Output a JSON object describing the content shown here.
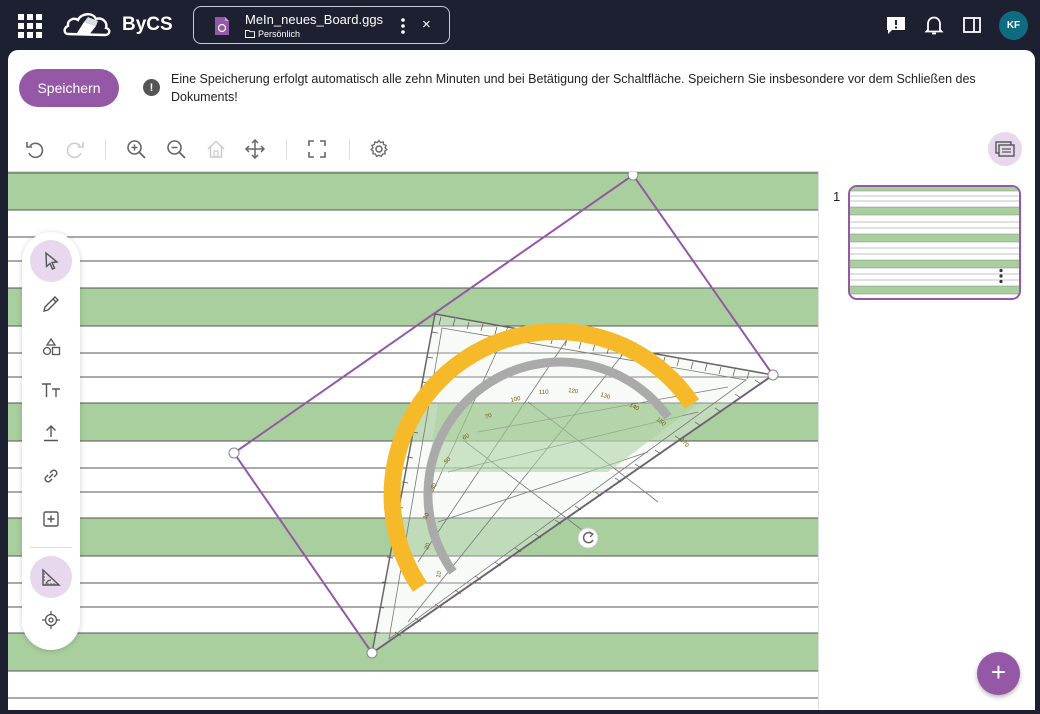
{
  "header": {
    "brand": "ByCS",
    "file_name": "MeIn_neues_Board.ggs",
    "file_location": "Persönlich",
    "close_glyph": "×",
    "avatar_initials": "KF",
    "icons": [
      "apps-grid-icon",
      "feedback-icon",
      "notifications-bell-icon",
      "side-panel-icon"
    ]
  },
  "save_bar": {
    "save_label": "Speichern",
    "info_glyph": "!",
    "info_text": "Eine Speicherung erfolgt automatisch alle zehn Minuten und bei Betätigung der Schaltfläche. Speichern Sie insbesondere vor dem Schließen des Dokuments!"
  },
  "toolbar": {
    "icons": [
      "undo-icon",
      "redo-icon",
      "zoom-in-icon",
      "zoom-out-icon",
      "home-view-icon",
      "pan-icon",
      "fullscreen-icon",
      "settings-icon",
      "pages-panel-icon"
    ]
  },
  "left_tools": [
    {
      "name": "select-tool",
      "icon": "cursor-icon",
      "active": true
    },
    {
      "name": "pen-tool",
      "icon": "pencil-icon",
      "active": false
    },
    {
      "name": "shapes-tool",
      "icon": "shapes-icon",
      "active": false
    },
    {
      "name": "text-tool",
      "icon": "text-icon",
      "active": false
    },
    {
      "name": "upload-tool",
      "icon": "upload-icon",
      "active": false
    },
    {
      "name": "link-tool",
      "icon": "link-icon",
      "active": false
    },
    {
      "name": "insert-tool",
      "icon": "add-box-icon",
      "active": false
    },
    {
      "name": "geodreieck-tool",
      "icon": "set-square-icon",
      "active": true
    },
    {
      "name": "laser-pointer-tool",
      "icon": "target-icon",
      "active": false
    }
  ],
  "pages": {
    "items": [
      {
        "number": "1"
      }
    ],
    "add_glyph": "+"
  },
  "colors": {
    "topbar": "#1c2030",
    "accent": "#9458a7",
    "accent_light": "#e7d8ee",
    "stripe_green": "#a9cf9e",
    "protractor_orange": "#f6b92a",
    "avatar": "#0f6c80"
  }
}
